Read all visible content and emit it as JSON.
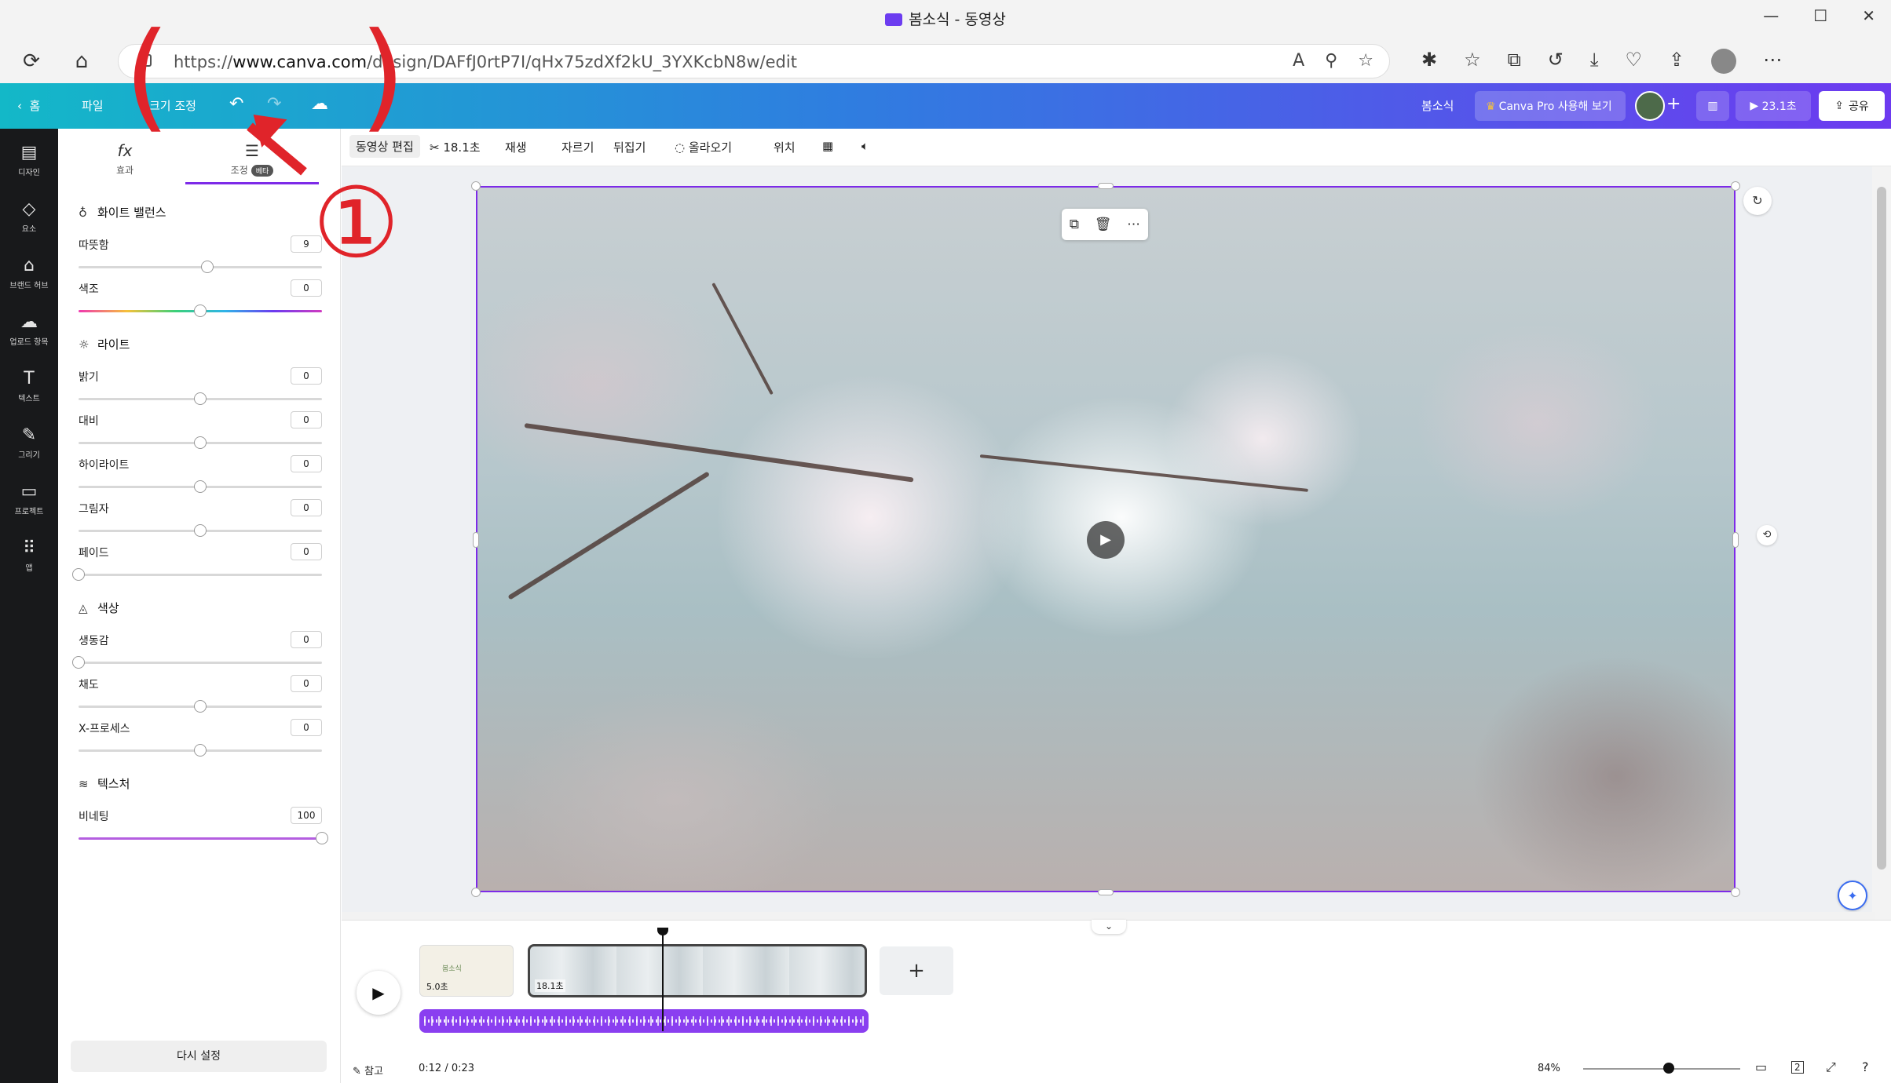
{
  "browser": {
    "window_title": "봄소식 - 동영상",
    "url_prefix": "https://",
    "url_host": "www.canva.com",
    "url_path": "/design/DAFfJ0rtP7I/qHx75zdXf2kU_3YXKcbN8w/edit"
  },
  "header": {
    "home": "홈",
    "file": "파일",
    "resize": "크기 조정",
    "project_name": "봄소식",
    "pro_button": "Canva Pro 사용해 보기",
    "play_duration": "23.1초",
    "share": "공유"
  },
  "rail": [
    {
      "icon": "layout-icon",
      "label": "디자인"
    },
    {
      "icon": "elements-icon",
      "label": "요소"
    },
    {
      "icon": "brand-icon",
      "label": "브랜드 허브"
    },
    {
      "icon": "upload-icon",
      "label": "업로드 항목"
    },
    {
      "icon": "text-icon",
      "label": "텍스트"
    },
    {
      "icon": "draw-icon",
      "label": "그리기"
    },
    {
      "icon": "folder-icon",
      "label": "프로젝트"
    },
    {
      "icon": "apps-icon",
      "label": "앱"
    }
  ],
  "panel": {
    "tab_effects": "효과",
    "tab_adjust": "조정",
    "beta": "베타",
    "white_balance": "화이트 밸런스",
    "warmth": {
      "label": "따뜻함",
      "value": "9"
    },
    "tint": {
      "label": "색조",
      "value": "0"
    },
    "light": "라이트",
    "brightness": {
      "label": "밝기",
      "value": "0"
    },
    "contrast": {
      "label": "대비",
      "value": "0"
    },
    "highlights": {
      "label": "하이라이트",
      "value": "0"
    },
    "shadows": {
      "label": "그림자",
      "value": "0"
    },
    "fade": {
      "label": "페이드",
      "value": "0"
    },
    "color": "색상",
    "vibrance": {
      "label": "생동감",
      "value": "0"
    },
    "saturation": {
      "label": "채도",
      "value": "0"
    },
    "xprocess": {
      "label": "X-프로세스",
      "value": "0"
    },
    "texture": "텍스처",
    "vignette": {
      "label": "비네팅",
      "value": "100"
    },
    "reset": "다시 설정"
  },
  "toolbar": {
    "edit_video": "동영상 편집",
    "duration": "18.1초",
    "playback": "재생",
    "crop": "자르기",
    "flip": "뒤집기",
    "animate": "올라오기",
    "position": "위치"
  },
  "timeline": {
    "clip1_duration": "5.0초",
    "clip1_title": "봄소식",
    "clip2_duration": "18.1초",
    "add": "+"
  },
  "footer": {
    "notes": "참고",
    "time": "0:12 / 0:23",
    "zoom": "84%",
    "page_count": "2"
  },
  "annotation": {
    "step": "①"
  }
}
